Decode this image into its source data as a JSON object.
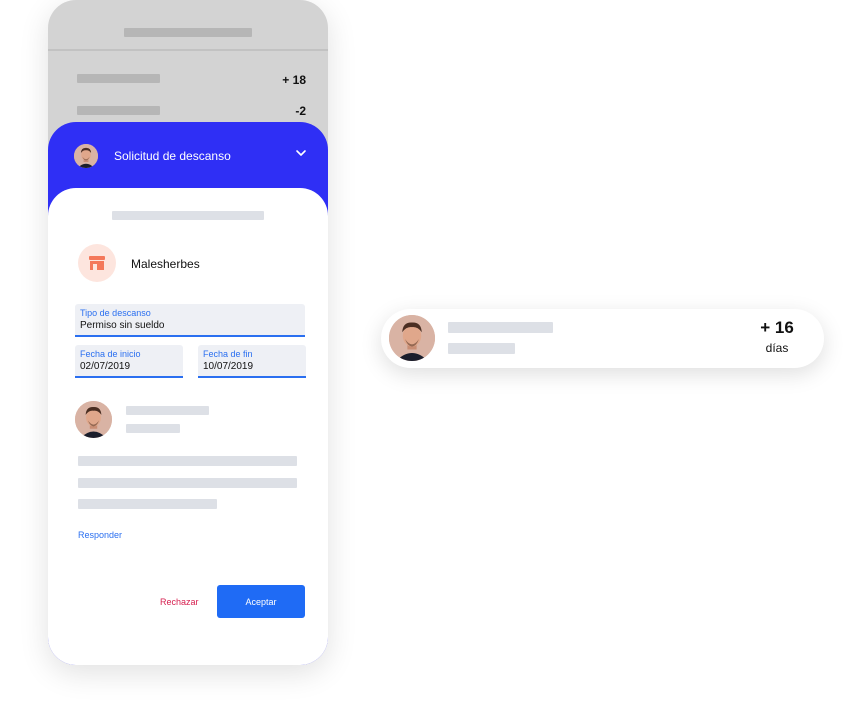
{
  "background_list": {
    "rows": [
      {
        "count": "+ 18"
      },
      {
        "count": "-2"
      }
    ]
  },
  "request": {
    "title": "Solicitud de descanso",
    "store_name": "Malesherbes",
    "fields": {
      "type": {
        "label": "Tipo de descanso",
        "value": "Permiso sin sueldo"
      },
      "start": {
        "label": "Fecha de inicio",
        "value": "02/07/2019"
      },
      "end": {
        "label": "Fecha de fin",
        "value": "10/07/2019"
      }
    },
    "reply_label": "Responder",
    "reject_label": "Rechazar",
    "accept_label": "Aceptar"
  },
  "balance_card": {
    "value": "+ 16",
    "unit": "días"
  },
  "colors": {
    "accent_blue": "#2f2ff5",
    "primary_button": "#1f6bf5",
    "reject_red": "#d61f4f",
    "link_blue": "#2a6ff0"
  },
  "icons": {
    "chevron": "chevron-down-icon",
    "store": "store-icon",
    "avatar": "avatar"
  }
}
